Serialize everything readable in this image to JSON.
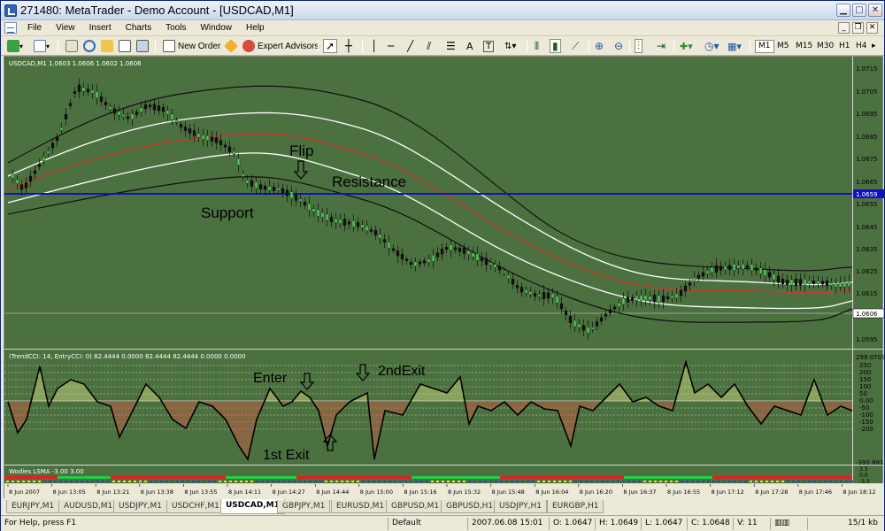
{
  "window": {
    "title": "271480: MetaTrader - Demo Account - [USDCAD,M1]"
  },
  "menu": {
    "items": [
      "File",
      "View",
      "Insert",
      "Charts",
      "Tools",
      "Window",
      "Help"
    ]
  },
  "toolbar": {
    "new_order": "New Order",
    "expert_advisors": "Expert Advisors",
    "timeframes": [
      "M1",
      "M5",
      "M15",
      "M30",
      "H1",
      "H4"
    ],
    "active_timeframe": "M1"
  },
  "chart": {
    "header": "USDCAD,M1  1.0603 1.0606 1.0602 1.0606",
    "price_levels": [
      "1.0715",
      "1.0705",
      "1.0695",
      "1.0685",
      "1.0675",
      "1.0665",
      "1.0655",
      "1.0645",
      "1.0635",
      "1.0625",
      "1.0615",
      "1.0595"
    ],
    "price_highlight": "1.0659",
    "price_current": "1.0606",
    "annotations": {
      "flip": "Flip",
      "resistance": "Resistance",
      "support": "Support",
      "enter": "Enter",
      "second_exit": "2ndExit",
      "first_exit": "1st Exit"
    },
    "cci_header": "(TrendCCI: 14, EntryCCI: 0)  82.4444 0.0000 82.4444 82.4444 0.0000 0.0000",
    "cci_levels": [
      "299.0703",
      "250",
      "200",
      "150",
      "100",
      "50",
      "0.00",
      "-50",
      "-100",
      "-150",
      "-200"
    ],
    "cci_bottom": "-393.8814",
    "wodies_header": "Wodies LSMA -3.00 3.00",
    "wodies_levels": [
      "3.3",
      "0.0",
      "-3.3"
    ],
    "time_labels": [
      "8 Jun 2007",
      "8 Jun 13:05",
      "8 Jun 13:21",
      "8 Jun 13:38",
      "8 Jun 13:55",
      "8 Jun 14:11",
      "8 Jun 14:27",
      "8 Jun 14:44",
      "8 Jun 15:00",
      "8 Jun 15:16",
      "8 Jun 15:32",
      "8 Jun 15:48",
      "8 Jun 16:04",
      "8 Jun 16:20",
      "8 Jun 16:37",
      "8 Jun 16:55",
      "8 Jun 17:12",
      "8 Jun 17:28",
      "8 Jun 17:46",
      "8 Jun 18:12"
    ]
  },
  "tabs": {
    "items": [
      "EURJPY,M1",
      "AUDUSD,M1",
      "USDJPY,M1",
      "USDCHF,M1",
      "USDCAD,M1",
      "GBPJPY,M1",
      "EURUSD,M1",
      "GBPUSD,M1",
      "GBPUSD,H1",
      "USDJPY,H1",
      "EURGBP,H1"
    ],
    "active": "USDCAD,M1"
  },
  "status": {
    "help": "For Help, press F1",
    "profile": "Default",
    "datetime": "2007.06.08 15:01",
    "open": "O: 1.0647",
    "high": "H: 1.0649",
    "low": "L: 1.0647",
    "close": "C: 1.0648",
    "volume": "V: 11",
    "traffic": "15/1 kb"
  },
  "colors": {
    "chart_bg": "#4c7140",
    "resistance": "#1010c8",
    "ma": "#c83a2a",
    "band_inner": "#ffffff",
    "band_outer": "#111111"
  }
}
